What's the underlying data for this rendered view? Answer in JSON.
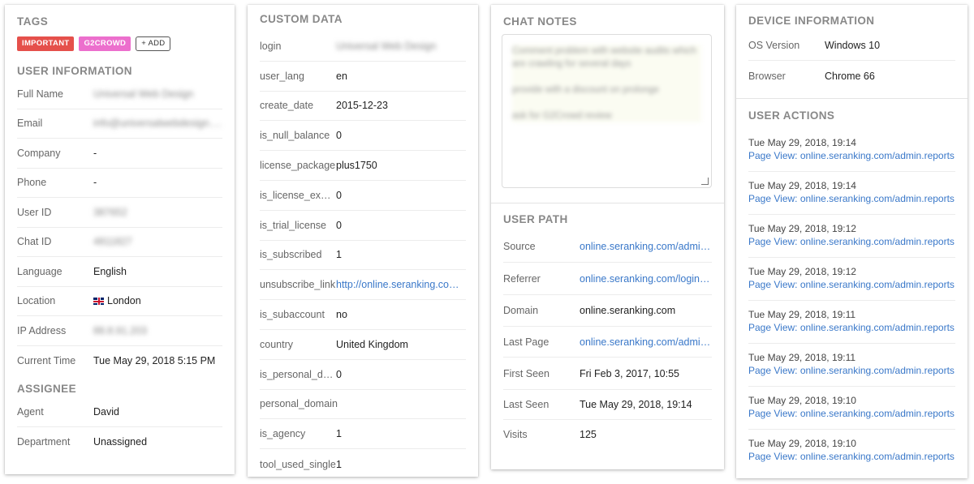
{
  "tags": {
    "title": "TAGS",
    "items": [
      {
        "label": "IMPORTANT",
        "color": "#e5504b"
      },
      {
        "label": "G2CROWD",
        "color": "#ec6fcd"
      }
    ],
    "add_label": "+ ADD"
  },
  "user_info": {
    "title": "USER INFORMATION",
    "rows": [
      {
        "label": "Full Name",
        "value": "Universal Web Design"
      },
      {
        "label": "Email",
        "value": "info@universalwebdesign.com"
      },
      {
        "label": "Company",
        "value": "-"
      },
      {
        "label": "Phone",
        "value": "-"
      },
      {
        "label": "User ID",
        "value": "387652"
      },
      {
        "label": "Chat ID",
        "value": "4811827"
      },
      {
        "label": "Language",
        "value": "English"
      },
      {
        "label": "Location",
        "value": "London"
      },
      {
        "label": "IP Address",
        "value": "88.8.91.203"
      },
      {
        "label": "Current Time",
        "value": "Tue May 29, 2018 5:15 PM"
      }
    ]
  },
  "assignee": {
    "title": "ASSIGNEE",
    "rows": [
      {
        "label": "Agent",
        "value": "David"
      },
      {
        "label": "Department",
        "value": "Unassigned"
      }
    ]
  },
  "custom_data": {
    "title": "CUSTOM DATA",
    "rows": [
      {
        "label": "login",
        "value": "Universal Web Design"
      },
      {
        "label": "user_lang",
        "value": "en"
      },
      {
        "label": "create_date",
        "value": "2015-12-23"
      },
      {
        "label": "is_null_balance",
        "value": "0"
      },
      {
        "label": "license_package",
        "value": "plus1750"
      },
      {
        "label": "is_license_expired",
        "value": "0"
      },
      {
        "label": "is_trial_license",
        "value": "0"
      },
      {
        "label": "is_subscribed",
        "value": "1"
      },
      {
        "label": "unsubscribe_link",
        "value": "http://online.seranking.com/unsubscribe"
      },
      {
        "label": "is_subaccount",
        "value": "no"
      },
      {
        "label": "country",
        "value": "United Kingdom"
      },
      {
        "label": "is_personal_domain",
        "value": "0"
      },
      {
        "label": "personal_domain",
        "value": ""
      },
      {
        "label": "is_agency",
        "value": "1"
      },
      {
        "label": "tool_used_single",
        "value": "1"
      }
    ]
  },
  "chat_notes": {
    "title": "CHAT NOTES",
    "text": "Comment problem with website audits which are crawling for several days\n\nprovide with a discount on prolonge\n\nask for G2Crowd review"
  },
  "user_path": {
    "title": "USER PATH",
    "rows": [
      {
        "label": "Source",
        "value": "online.seranking.com/admin/reports"
      },
      {
        "label": "Referrer",
        "value": "online.seranking.com/login.html"
      },
      {
        "label": "Domain",
        "value": "online.seranking.com"
      },
      {
        "label": "Last Page",
        "value": "online.seranking.com/admin/reports"
      },
      {
        "label": "First Seen",
        "value": "Fri Feb 3, 2017, 10:55"
      },
      {
        "label": "Last Seen",
        "value": "Tue May 29, 2018, 19:14"
      },
      {
        "label": "Visits",
        "value": "125"
      }
    ]
  },
  "device_info": {
    "title": "DEVICE INFORMATION",
    "rows": [
      {
        "label": "OS Version",
        "value": "Windows 10"
      },
      {
        "label": "Browser",
        "value": "Chrome 66"
      }
    ]
  },
  "user_actions": {
    "title": "USER ACTIONS",
    "items": [
      {
        "time": "Tue May 29, 2018, 19:14",
        "link": "Page View: online.seranking.com/admin.reports"
      },
      {
        "time": "Tue May 29, 2018, 19:14",
        "link": "Page View: online.seranking.com/admin.reports"
      },
      {
        "time": "Tue May 29, 2018, 19:12",
        "link": "Page View: online.seranking.com/admin.reports"
      },
      {
        "time": "Tue May 29, 2018, 19:12",
        "link": "Page View: online.seranking.com/admin.reports"
      },
      {
        "time": "Tue May 29, 2018, 19:11",
        "link": "Page View: online.seranking.com/admin.reports"
      },
      {
        "time": "Tue May 29, 2018, 19:11",
        "link": "Page View: online.seranking.com/admin.reports"
      },
      {
        "time": "Tue May 29, 2018, 19:10",
        "link": "Page View: online.seranking.com/admin.reports"
      },
      {
        "time": "Tue May 29, 2018, 19:10",
        "link": "Page View: online.seranking.com/admin.reports"
      }
    ]
  },
  "icons": {
    "location_flag": "uk-flag-icon",
    "notes_resize": "resize-handle-icon"
  }
}
